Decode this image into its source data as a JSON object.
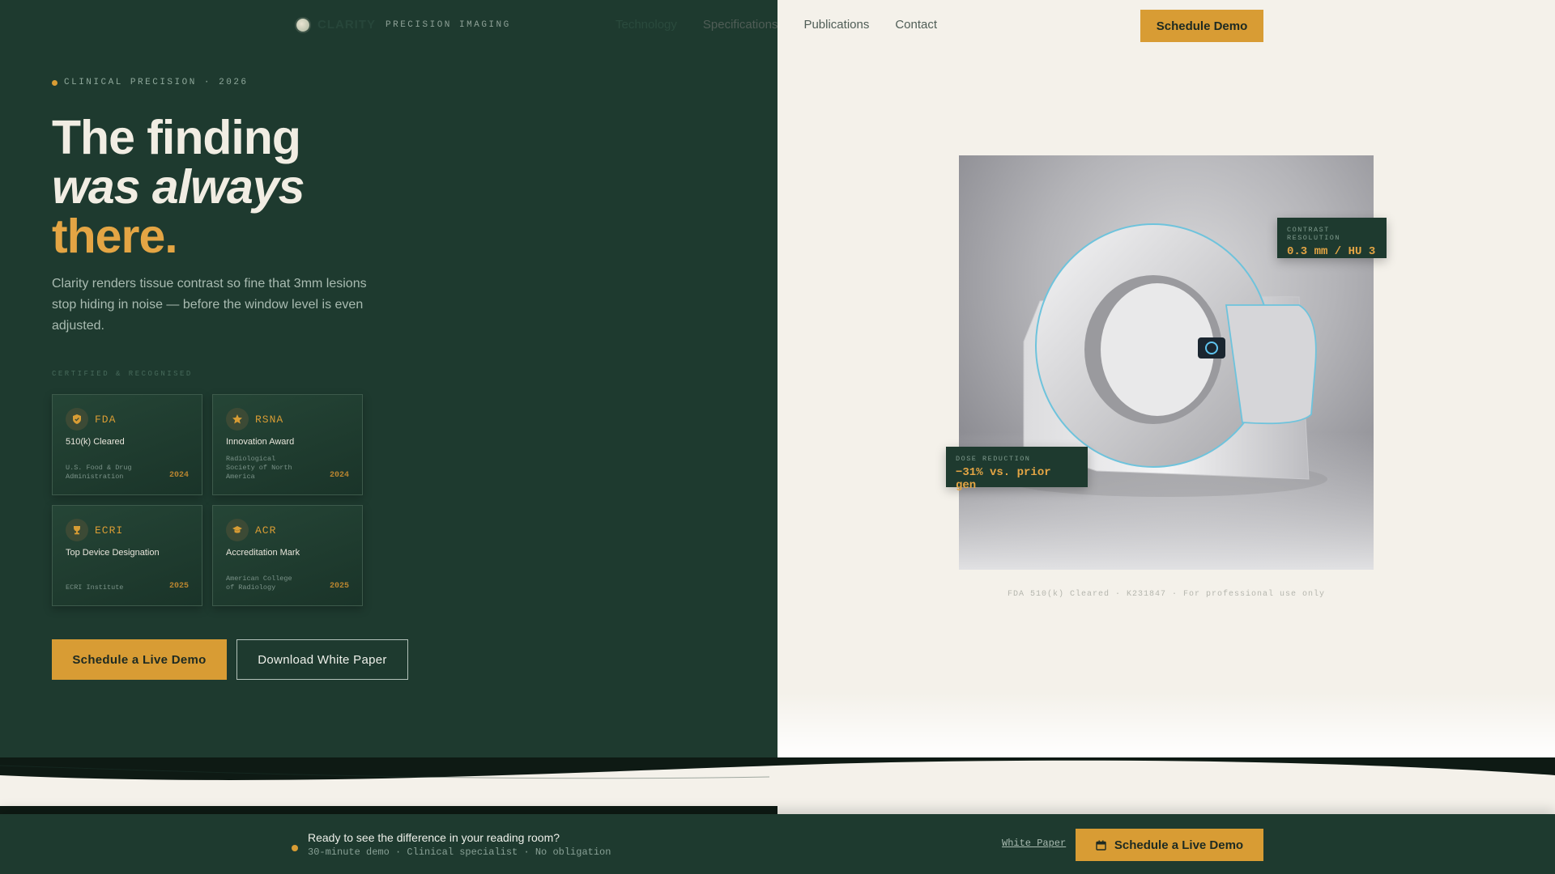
{
  "nav": {
    "brand_name": "CLARITY",
    "brand_tag": "PRECISION IMAGING",
    "links": [
      "Technology",
      "Specifications",
      "Publications",
      "Contact"
    ],
    "cta": "Schedule Demo"
  },
  "hero": {
    "eyebrow": "CLINICAL PRECISION · 2026",
    "headline_1": "The finding",
    "headline_2": "was always",
    "headline_3": "there.",
    "subtitle": "Clarity renders tissue contrast so fine that 3mm lesions stop hiding in noise — before the window level is even adjusted.",
    "cert_label": "CERTIFIED & RECOGNISED",
    "cards": [
      {
        "abbr": "FDA",
        "title": "510(k) Cleared",
        "org": "U.S. Food & Drug Administration",
        "year": "2024",
        "icon": "shield-icon"
      },
      {
        "abbr": "RSNA",
        "title": "Innovation Award",
        "org": "Radiological Society of North America",
        "year": "2024",
        "icon": "star-icon"
      },
      {
        "abbr": "ECRI",
        "title": "Top Device Designation",
        "org": "ECRI Institute",
        "year": "2025",
        "icon": "trophy-icon"
      },
      {
        "abbr": "ACR",
        "title": "Accreditation Mark",
        "org": "American College of Radiology",
        "year": "2025",
        "icon": "graduation-cap-icon"
      }
    ],
    "primary_btn": "Schedule a Live Demo",
    "secondary_btn": "Download White Paper"
  },
  "device": {
    "contrast_label": "CONTRAST RESOLUTION",
    "contrast_value": "0.3 mm / HU 3",
    "dose_label": "DOSE REDUCTION",
    "dose_value": "−31% vs. prior gen",
    "caption": "FDA 510(k) Cleared · K231847 · For professional use only"
  },
  "cta_bar": {
    "title": "Ready to see the difference in your reading room?",
    "subtitle": "30-minute demo · Clinical specialist · No obligation",
    "link": "White Paper",
    "button": "Schedule a Live Demo"
  },
  "colors": {
    "forest": "#1e3a2f",
    "amber": "#d89c34",
    "cream": "#f4f1ea"
  }
}
